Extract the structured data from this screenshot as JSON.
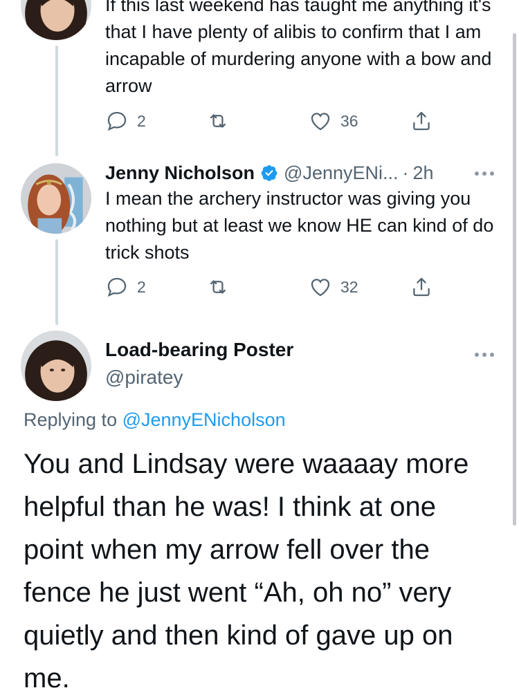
{
  "tweet1": {
    "text": "If this last weekend has taught me anything it's that I have plenty of alibis to confirm that I am incapable of murdering anyone with a bow and arrow",
    "reply_count": "2",
    "like_count": "36"
  },
  "tweet2": {
    "name": "Jenny Nicholson",
    "handle": "@JennyENi...",
    "separator": "·",
    "time": "2h",
    "text": "I mean the archery instructor was giving you nothing but at least we know HE can kind of do trick shots",
    "reply_count": "2",
    "like_count": "32"
  },
  "main": {
    "name": "Load-bearing Poster",
    "handle": "@piratey",
    "replying_prefix": "Replying to ",
    "replying_handle": "@JennyENicholson",
    "text": "You and Lindsay were waaaay more helpful than he was! I think at one point when my arrow fell over the fence he just went “Ah, oh no” very quietly and then kind of gave up on me."
  },
  "icons": [
    "reply-icon",
    "retweet-icon",
    "like-icon",
    "share-icon",
    "verified-icon",
    "more-icon"
  ],
  "colors": {
    "text": "#0f1419",
    "secondary": "#536471",
    "link": "#1d9bf0",
    "verified": "#1d9bf0",
    "thread_line": "#cfd9de"
  }
}
